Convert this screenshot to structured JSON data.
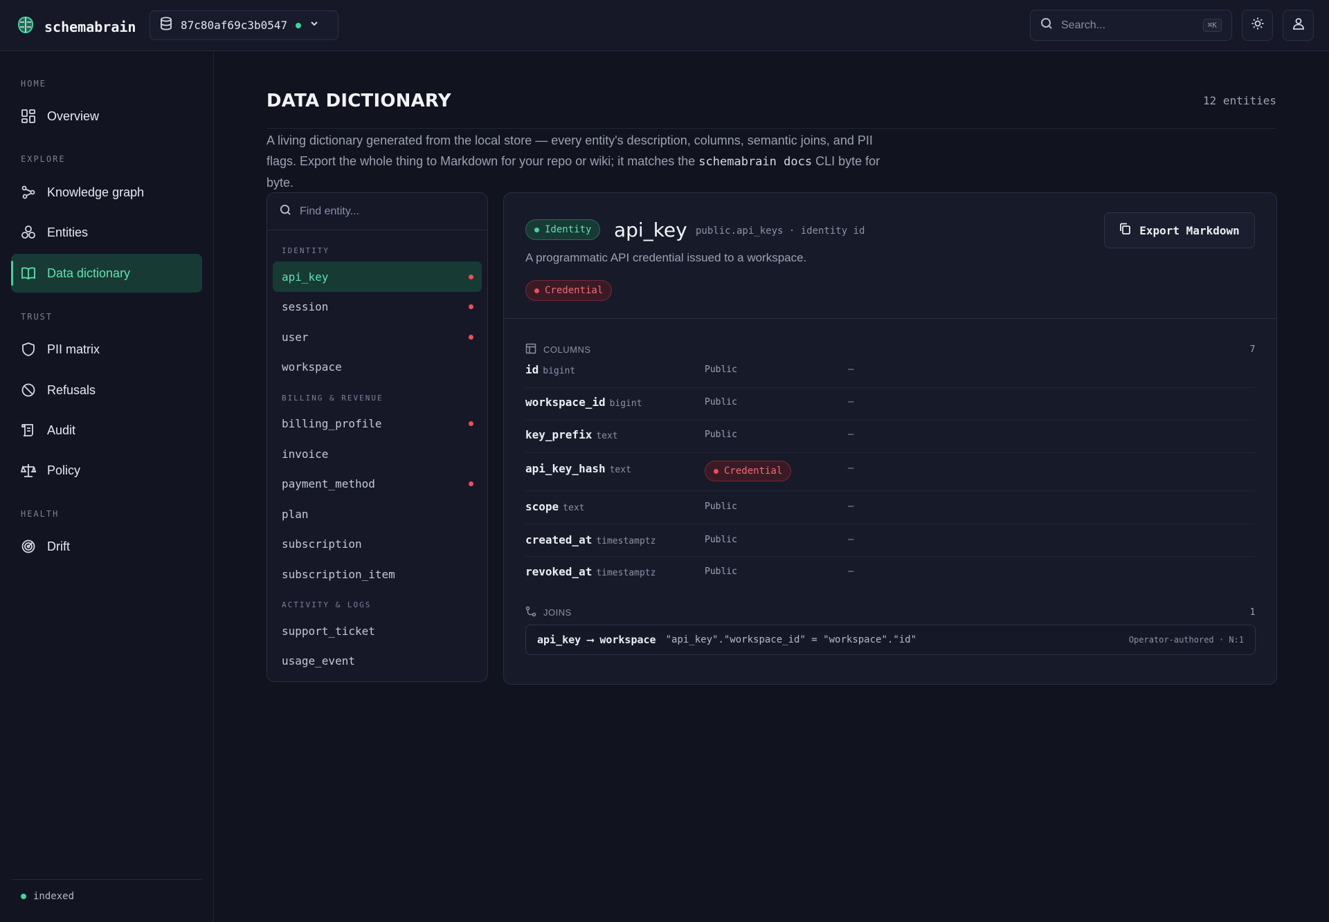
{
  "app": {
    "name": "schemabrain",
    "database_id": "87c80af69c3b0547",
    "search_placeholder": "Search...",
    "search_shortcut": "⌘K"
  },
  "sidebar": {
    "sections": [
      {
        "label": "HOME",
        "items": [
          {
            "label": "Overview",
            "icon": "grid-icon"
          }
        ]
      },
      {
        "label": "EXPLORE",
        "items": [
          {
            "label": "Knowledge graph",
            "icon": "graph-icon"
          },
          {
            "label": "Entities",
            "icon": "entities-icon"
          },
          {
            "label": "Data dictionary",
            "icon": "book-icon",
            "active": true
          }
        ]
      },
      {
        "label": "TRUST",
        "items": [
          {
            "label": "PII matrix",
            "icon": "shield-icon"
          },
          {
            "label": "Refusals",
            "icon": "ban-icon"
          },
          {
            "label": "Audit",
            "icon": "scroll-icon"
          },
          {
            "label": "Policy",
            "icon": "scale-icon"
          }
        ]
      },
      {
        "label": "HEALTH",
        "items": [
          {
            "label": "Drift",
            "icon": "radar-icon"
          }
        ]
      }
    ],
    "status": "indexed"
  },
  "page": {
    "title": "DATA DICTIONARY",
    "count": "12 entities",
    "intro_before": "A living dictionary generated from the local store — every entity's description, columns, semantic joins, and PII flags. Export the whole thing to Markdown for your repo or wiki; it matches the ",
    "intro_code": "schemabrain docs",
    "intro_after": " CLI byte for byte."
  },
  "entity_list": {
    "placeholder": "Find entity...",
    "groups": [
      {
        "label": "IDENTITY",
        "entities": [
          {
            "name": "api_key",
            "pii": true,
            "active": true
          },
          {
            "name": "session",
            "pii": true
          },
          {
            "name": "user",
            "pii": true
          },
          {
            "name": "workspace",
            "pii": false
          }
        ]
      },
      {
        "label": "BILLING & REVENUE",
        "entities": [
          {
            "name": "billing_profile",
            "pii": true
          },
          {
            "name": "invoice",
            "pii": false
          },
          {
            "name": "payment_method",
            "pii": true
          },
          {
            "name": "plan",
            "pii": false
          },
          {
            "name": "subscription",
            "pii": false
          },
          {
            "name": "subscription_item",
            "pii": false
          }
        ]
      },
      {
        "label": "ACTIVITY & LOGS",
        "entities": [
          {
            "name": "support_ticket",
            "pii": false
          },
          {
            "name": "usage_event",
            "pii": false
          }
        ]
      }
    ]
  },
  "detail": {
    "domain_badge": "Identity",
    "name": "api_key",
    "meta": "public.api_keys · identity id",
    "description": "A programmatic API credential issued to a workspace.",
    "pii_badge": "Credential",
    "export_label": "Export Markdown",
    "columns_label": "COLUMNS",
    "columns_count": "7",
    "columns": [
      {
        "name": "id",
        "type": "bigint",
        "class": "Public",
        "note": "–"
      },
      {
        "name": "workspace_id",
        "type": "bigint",
        "class": "Public",
        "note": "–"
      },
      {
        "name": "key_prefix",
        "type": "text",
        "class": "Public",
        "note": "–"
      },
      {
        "name": "api_key_hash",
        "type": "text",
        "class": "Credential",
        "pii": true,
        "note": "–"
      },
      {
        "name": "scope",
        "type": "text",
        "class": "Public",
        "note": "–"
      },
      {
        "name": "created_at",
        "type": "timestamptz",
        "class": "Public",
        "note": "–"
      },
      {
        "name": "revoked_at",
        "type": "timestamptz",
        "class": "Public",
        "note": "–"
      }
    ],
    "joins_label": "JOINS",
    "joins_count": "1",
    "joins": [
      {
        "from": "api_key",
        "arrow": "⟶",
        "to": "workspace",
        "sql": "\"api_key\".\"workspace_id\" = \"workspace\".\"id\"",
        "meta": "Operator-authored · N:1"
      }
    ]
  },
  "colors": {
    "accent": "#3ed49a",
    "pii_red": "#ee4d5a",
    "background": "#11131e"
  }
}
